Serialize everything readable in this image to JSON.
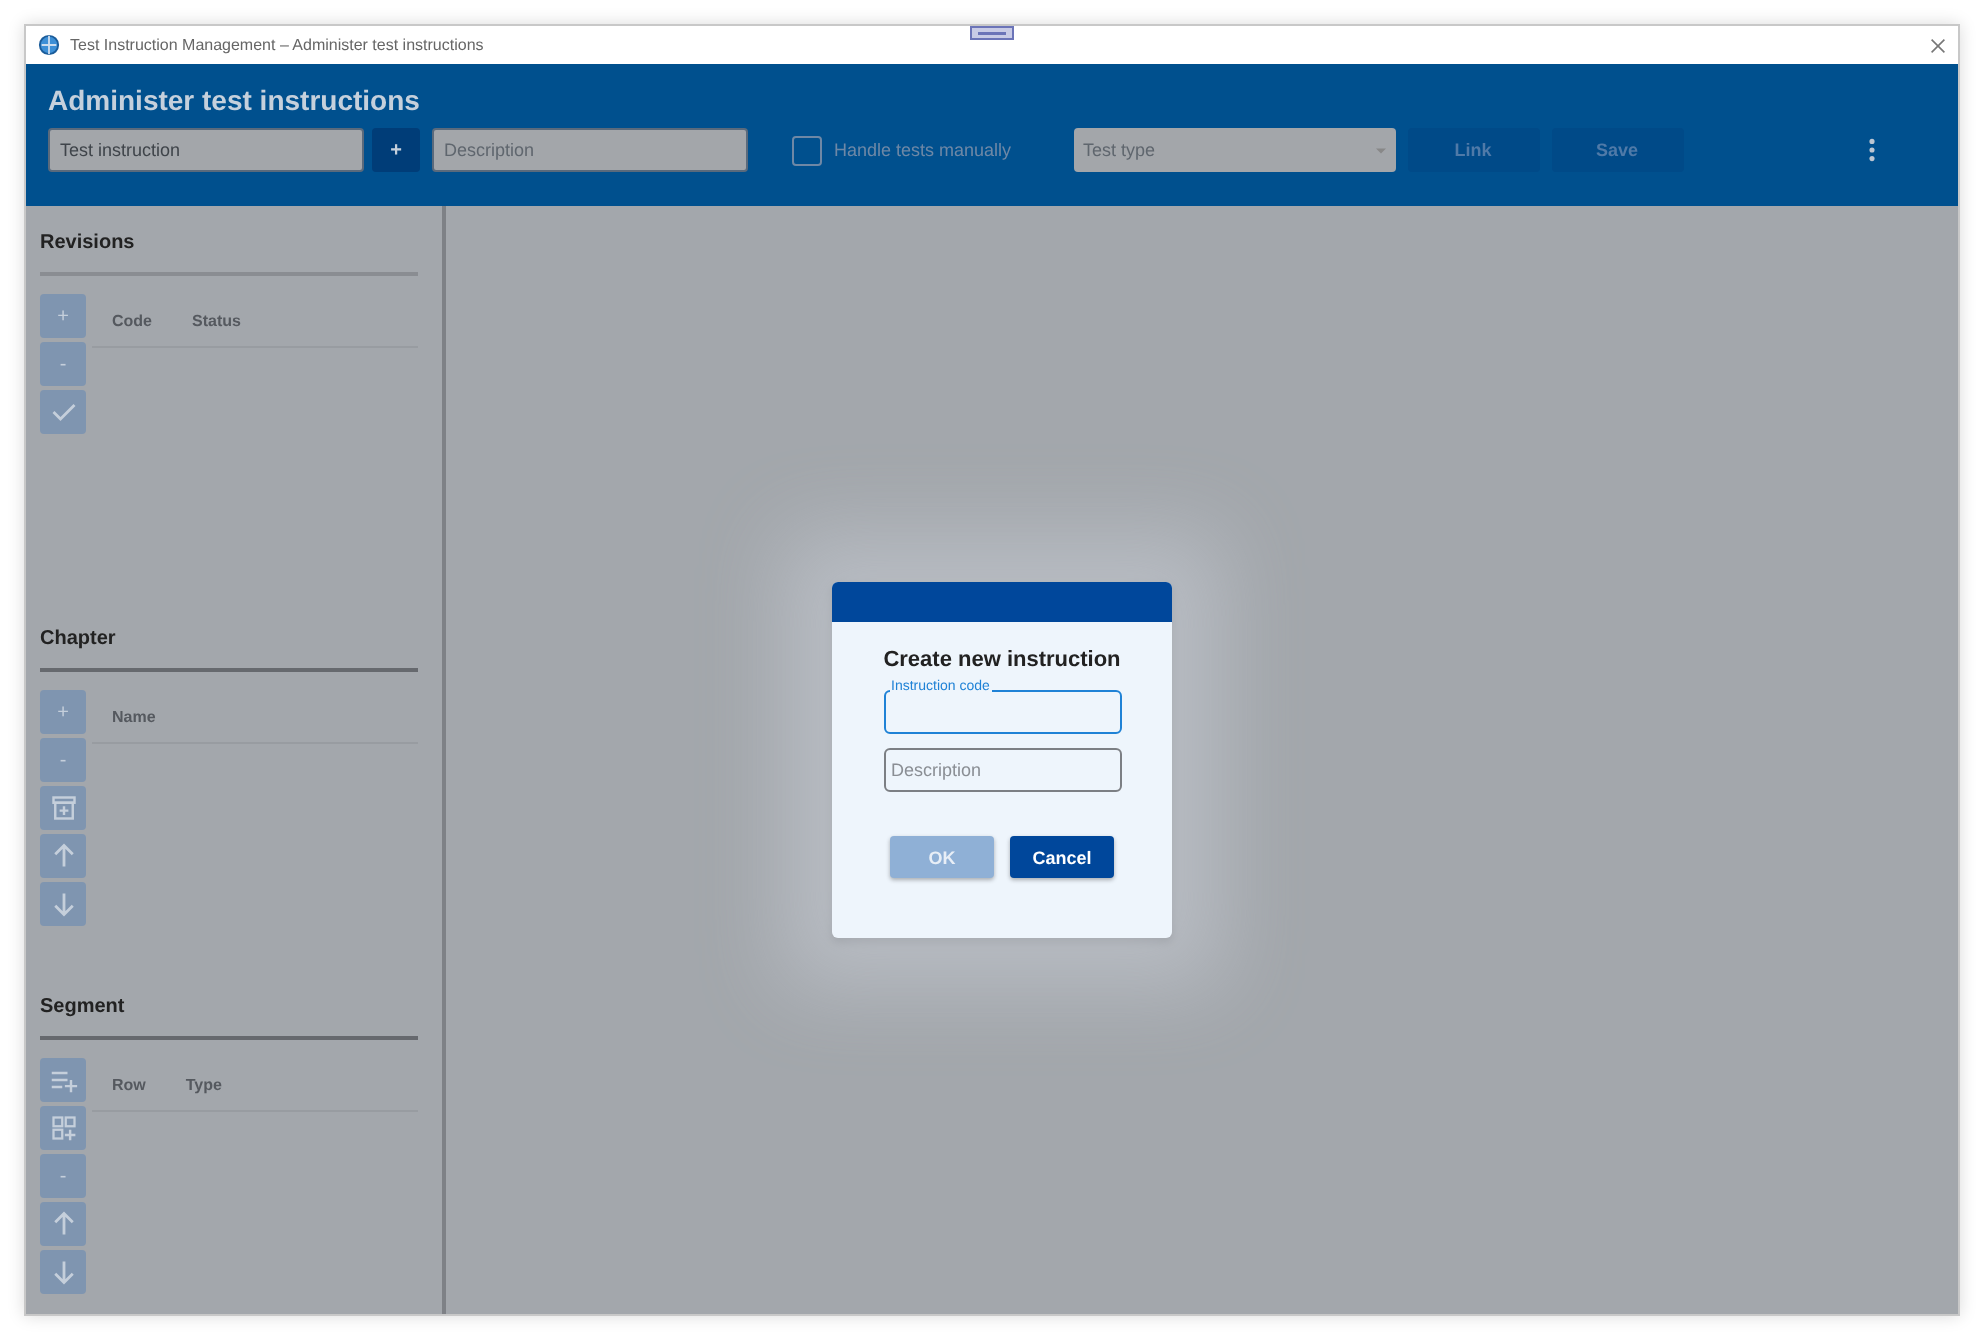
{
  "window": {
    "title": "Test Instruction Management – Administer test instructions"
  },
  "header": {
    "title": "Administer test instructions",
    "instruction_field": {
      "value": "Test instruction"
    },
    "add_button": "+",
    "description_field": {
      "placeholder": "Description"
    },
    "handle_manually": {
      "label": "Handle tests manually",
      "checked": false
    },
    "test_type": {
      "placeholder": "Test type"
    },
    "buttons": [
      {
        "label": "Link",
        "disabled": true
      },
      {
        "label": "Save",
        "disabled": true
      }
    ]
  },
  "panels": [
    {
      "title": "Revisions",
      "columns": [
        "Code",
        "Status"
      ],
      "actions": [
        {
          "kind": "text",
          "label": "+"
        },
        {
          "kind": "text",
          "label": "-"
        },
        {
          "kind": "check"
        }
      ]
    },
    {
      "title": "Chapter",
      "columns": [
        "Name"
      ],
      "actions": [
        {
          "kind": "text",
          "label": "+"
        },
        {
          "kind": "text",
          "label": "-"
        },
        {
          "kind": "archive"
        },
        {
          "kind": "up"
        },
        {
          "kind": "down"
        }
      ]
    },
    {
      "title": "Segment",
      "columns": [
        "Row",
        "Type"
      ],
      "actions": [
        {
          "kind": "list-add"
        },
        {
          "kind": "grid-add"
        },
        {
          "kind": "text",
          "label": "-"
        },
        {
          "kind": "up"
        },
        {
          "kind": "down"
        }
      ]
    }
  ],
  "dialog": {
    "title": "Create new instruction",
    "fields": [
      {
        "label": "Instruction code",
        "focused": true
      },
      {
        "placeholder": "Description",
        "focused": false
      }
    ],
    "buttons": [
      {
        "label": "OK",
        "disabled": true
      },
      {
        "label": "Cancel",
        "disabled": false
      }
    ]
  }
}
